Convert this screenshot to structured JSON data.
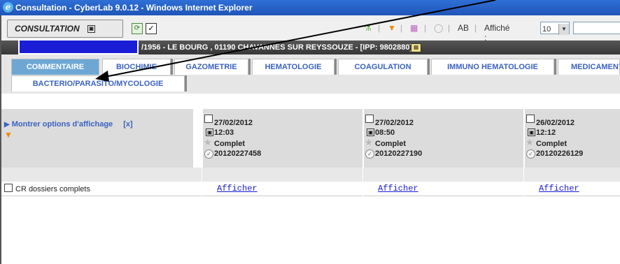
{
  "window": {
    "title": "Consultation - CyberLab 9.0.12 - Windows Internet Explorer"
  },
  "toolbar": {
    "consultation_label": "CONSULTATION",
    "text_toggle": "AB",
    "affiche_label": "Affiché :",
    "affiche_value": "10",
    "icons": [
      "flask-icon",
      "funnel-icon",
      "chart-icon",
      "circle-icon"
    ]
  },
  "patient": {
    "info": "/1956 - LE BOURG , 01190 CHAVANNES SUR REYSSOUZE - [IPP: 9802880]"
  },
  "tabs": [
    {
      "label": "COMMENTAIRE",
      "active": true
    },
    {
      "label": "BIOCHIMIE"
    },
    {
      "label": "GAZOMETRIE"
    },
    {
      "label": "HEMATOLOGIE"
    },
    {
      "label": "COAGULATION"
    },
    {
      "label": "IMMUNO HEMATOLOGIE"
    },
    {
      "label": "MEDICAMENTS"
    },
    {
      "label": "BACTERIO/PARASITO/MYCOLOGIE"
    }
  ],
  "options": {
    "show_label": "Montrer options d'affichage",
    "close_label": "[x]"
  },
  "results": [
    {
      "date": "27/02/2012",
      "time": "12:03",
      "status": "Complet",
      "number": "20120227458"
    },
    {
      "date": "27/02/2012",
      "time": "08:50",
      "status": "Complet",
      "number": "20120227190"
    },
    {
      "date": "26/02/2012",
      "time": "12:12",
      "status": "Complet",
      "number": "20120226129"
    }
  ],
  "rows": {
    "cr_label": "CR dossiers complets",
    "afficher_label": "Afficher"
  },
  "colors": {
    "title_bar": "#2f6fd6",
    "active_tab": "#6ea7d4",
    "link": "#1a1ad6",
    "redaction": "#1a1ed6"
  }
}
